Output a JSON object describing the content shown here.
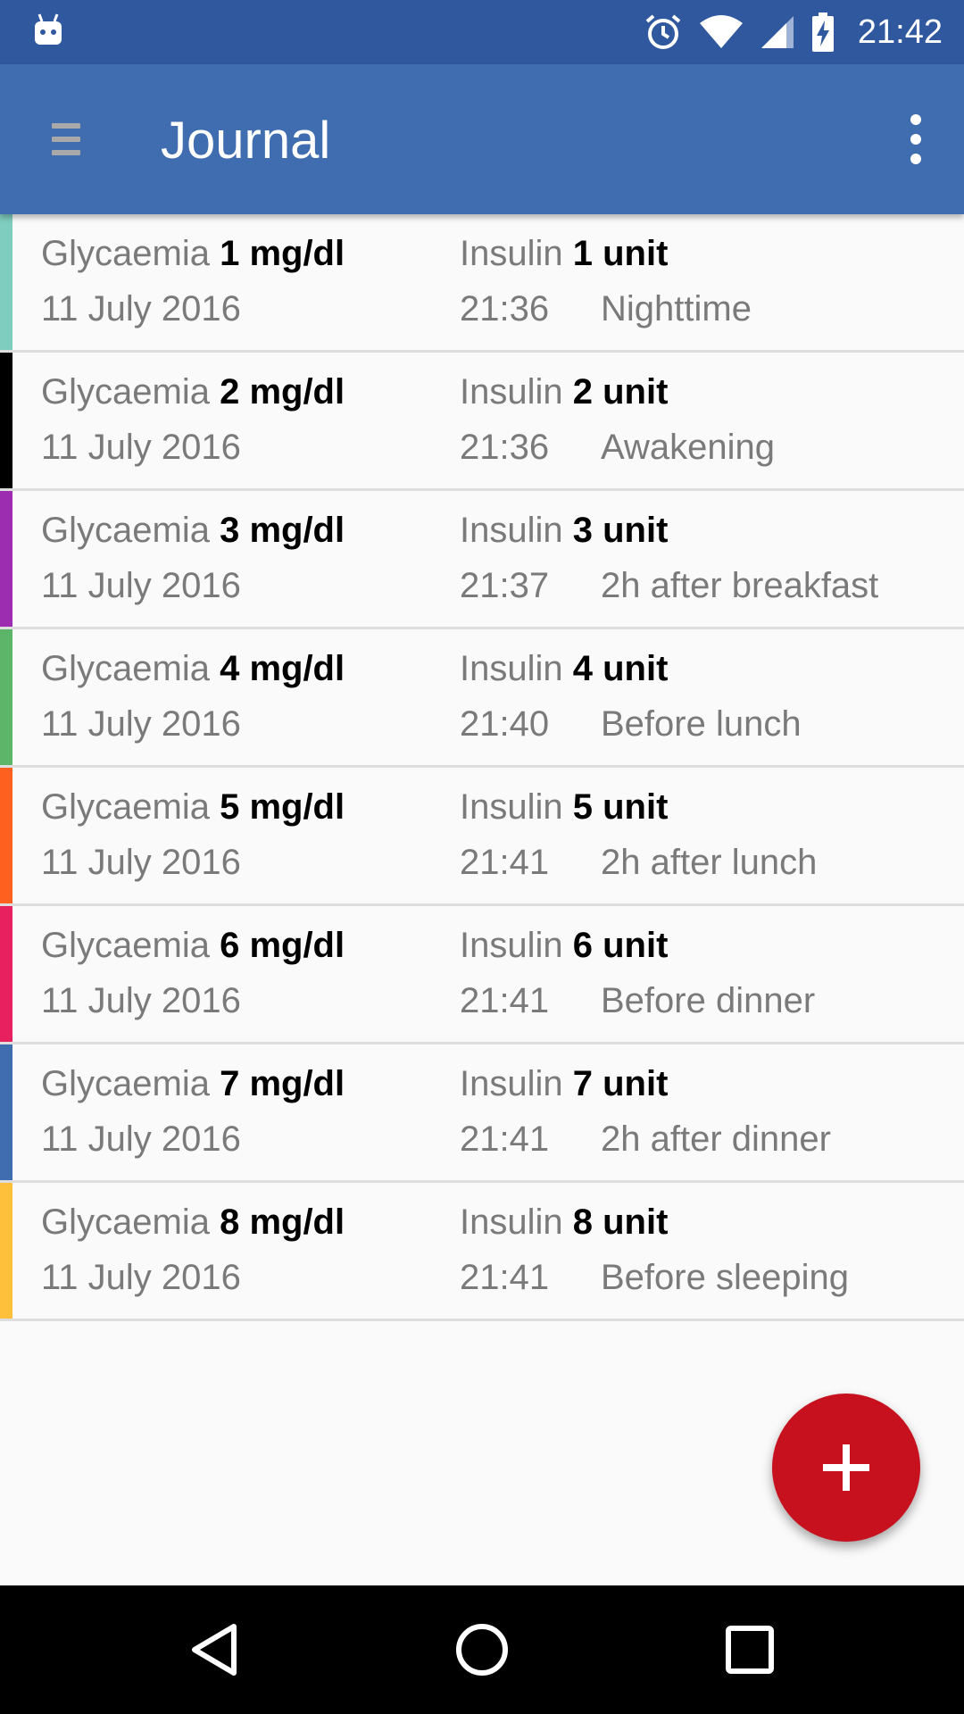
{
  "status_bar": {
    "time": "21:42"
  },
  "app_bar": {
    "title": "Journal"
  },
  "colors": {
    "status_bar": "#30589e",
    "app_bar": "#3f6db0",
    "fab": "#c8111e"
  },
  "entries": [
    {
      "glycaemia_label": "Glycaemia",
      "glycaemia_value": "1 mg/dl",
      "insulin_label": "Insulin",
      "insulin_value": "1 unit",
      "date": "11 July 2016",
      "time": "21:36",
      "moment": "Nighttime",
      "color": "#7fcdbe"
    },
    {
      "glycaemia_label": "Glycaemia",
      "glycaemia_value": "2 mg/dl",
      "insulin_label": "Insulin",
      "insulin_value": "2 unit",
      "date": "11 July 2016",
      "time": "21:36",
      "moment": "Awakening",
      "color": "#000000"
    },
    {
      "glycaemia_label": "Glycaemia",
      "glycaemia_value": "3 mg/dl",
      "insulin_label": "Insulin",
      "insulin_value": "3 unit",
      "date": "11 July 2016",
      "time": "21:37",
      "moment": "2h after breakfast",
      "color": "#9c2cb0"
    },
    {
      "glycaemia_label": "Glycaemia",
      "glycaemia_value": "4 mg/dl",
      "insulin_label": "Insulin",
      "insulin_value": "4 unit",
      "date": "11 July 2016",
      "time": "21:40",
      "moment": "Before lunch",
      "color": "#5db56a"
    },
    {
      "glycaemia_label": "Glycaemia",
      "glycaemia_value": "5 mg/dl",
      "insulin_label": "Insulin",
      "insulin_value": "5 unit",
      "date": "11 July 2016",
      "time": "21:41",
      "moment": "2h after lunch",
      "color": "#fe6020"
    },
    {
      "glycaemia_label": "Glycaemia",
      "glycaemia_value": "6 mg/dl",
      "insulin_label": "Insulin",
      "insulin_value": "6 unit",
      "date": "11 July 2016",
      "time": "21:41",
      "moment": "Before dinner",
      "color": "#e9205f"
    },
    {
      "glycaemia_label": "Glycaemia",
      "glycaemia_value": "7 mg/dl",
      "insulin_label": "Insulin",
      "insulin_value": "7 unit",
      "date": "11 July 2016",
      "time": "21:41",
      "moment": "2h after dinner",
      "color": "#3f6db0"
    },
    {
      "glycaemia_label": "Glycaemia",
      "glycaemia_value": "8 mg/dl",
      "insulin_label": "Insulin",
      "insulin_value": "8 unit",
      "date": "11 July 2016",
      "time": "21:41",
      "moment": "Before sleeping",
      "color": "#fec03a"
    }
  ],
  "icons": {
    "status": [
      "android-debug-icon",
      "alarm-icon",
      "wifi-icon",
      "cellular-signal-icon",
      "battery-charging-icon"
    ],
    "app_bar": [
      "menu-icon",
      "overflow-menu-icon"
    ],
    "fab": "plus-icon",
    "nav": [
      "back-icon",
      "home-icon",
      "recents-icon"
    ]
  }
}
